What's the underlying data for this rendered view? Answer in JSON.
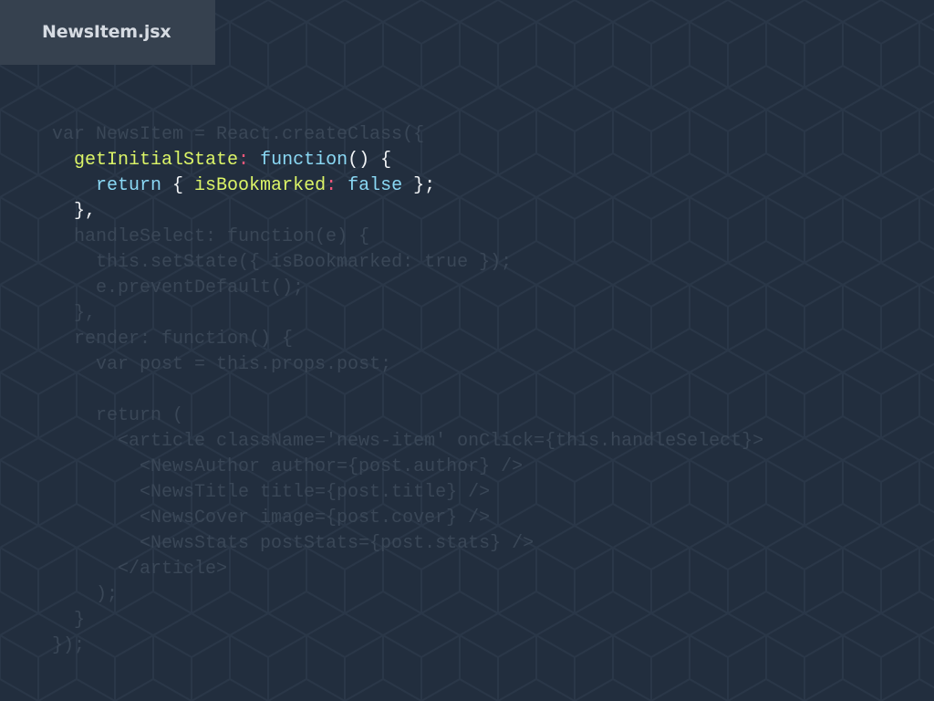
{
  "file_tab": {
    "label": "NewsItem.jsx"
  },
  "code_lines": [
    {
      "dim": true,
      "indent": 0,
      "tokens": [
        {
          "t": "plain",
          "v": "var NewsItem = React.createClass({"
        }
      ]
    },
    {
      "dim": false,
      "indent": 1,
      "tokens": [
        {
          "t": "prop",
          "v": "getInitialState"
        },
        {
          "t": "colon",
          "v": ":"
        },
        {
          "t": "plain",
          "v": " "
        },
        {
          "t": "kw",
          "v": "function"
        },
        {
          "t": "plain",
          "v": "() {"
        }
      ]
    },
    {
      "dim": false,
      "indent": 2,
      "tokens": [
        {
          "t": "kw",
          "v": "return"
        },
        {
          "t": "plain",
          "v": " { "
        },
        {
          "t": "prop",
          "v": "isBookmarked"
        },
        {
          "t": "colon",
          "v": ":"
        },
        {
          "t": "plain",
          "v": " "
        },
        {
          "t": "kw",
          "v": "false"
        },
        {
          "t": "plain",
          "v": " };"
        }
      ]
    },
    {
      "dim": false,
      "indent": 1,
      "tokens": [
        {
          "t": "plain",
          "v": "},"
        }
      ]
    },
    {
      "dim": true,
      "indent": 1,
      "tokens": [
        {
          "t": "plain",
          "v": "handleSelect: function(e) {"
        }
      ]
    },
    {
      "dim": true,
      "indent": 2,
      "tokens": [
        {
          "t": "plain",
          "v": "this.setState({ isBookmarked: true });"
        }
      ]
    },
    {
      "dim": true,
      "indent": 2,
      "tokens": [
        {
          "t": "plain",
          "v": "e.preventDefault();"
        }
      ]
    },
    {
      "dim": true,
      "indent": 1,
      "tokens": [
        {
          "t": "plain",
          "v": "},"
        }
      ]
    },
    {
      "dim": true,
      "indent": 1,
      "tokens": [
        {
          "t": "plain",
          "v": "render: function() {"
        }
      ]
    },
    {
      "dim": true,
      "indent": 2,
      "tokens": [
        {
          "t": "plain",
          "v": "var post = this.props.post;"
        }
      ]
    },
    {
      "dim": true,
      "indent": 0,
      "tokens": [
        {
          "t": "plain",
          "v": ""
        }
      ]
    },
    {
      "dim": true,
      "indent": 2,
      "tokens": [
        {
          "t": "plain",
          "v": "return ("
        }
      ]
    },
    {
      "dim": true,
      "indent": 3,
      "tokens": [
        {
          "t": "plain",
          "v": "<article className='news-item' onClick={this.handleSelect}>"
        }
      ]
    },
    {
      "dim": true,
      "indent": 4,
      "tokens": [
        {
          "t": "plain",
          "v": "<NewsAuthor author={post.author} />"
        }
      ]
    },
    {
      "dim": true,
      "indent": 4,
      "tokens": [
        {
          "t": "plain",
          "v": "<NewsTitle title={post.title} />"
        }
      ]
    },
    {
      "dim": true,
      "indent": 4,
      "tokens": [
        {
          "t": "plain",
          "v": "<NewsCover image={post.cover} />"
        }
      ]
    },
    {
      "dim": true,
      "indent": 4,
      "tokens": [
        {
          "t": "plain",
          "v": "<NewsStats postStats={post.stats} />"
        }
      ]
    },
    {
      "dim": true,
      "indent": 3,
      "tokens": [
        {
          "t": "plain",
          "v": "</article>"
        }
      ]
    },
    {
      "dim": true,
      "indent": 2,
      "tokens": [
        {
          "t": "plain",
          "v": ");"
        }
      ]
    },
    {
      "dim": true,
      "indent": 1,
      "tokens": [
        {
          "t": "plain",
          "v": "}"
        }
      ]
    },
    {
      "dim": true,
      "indent": 0,
      "tokens": [
        {
          "t": "plain",
          "v": "});"
        }
      ]
    }
  ],
  "colors": {
    "background": "#222e3e",
    "pattern_stroke": "#2b3849",
    "tab_background": "#36414f",
    "tab_text": "#d6dbe2",
    "dim_code": "#3a4757",
    "property": "#dcf567",
    "colon": "#f2577a",
    "keyword": "#8ad8f4",
    "plain": "#f2f4f6"
  }
}
